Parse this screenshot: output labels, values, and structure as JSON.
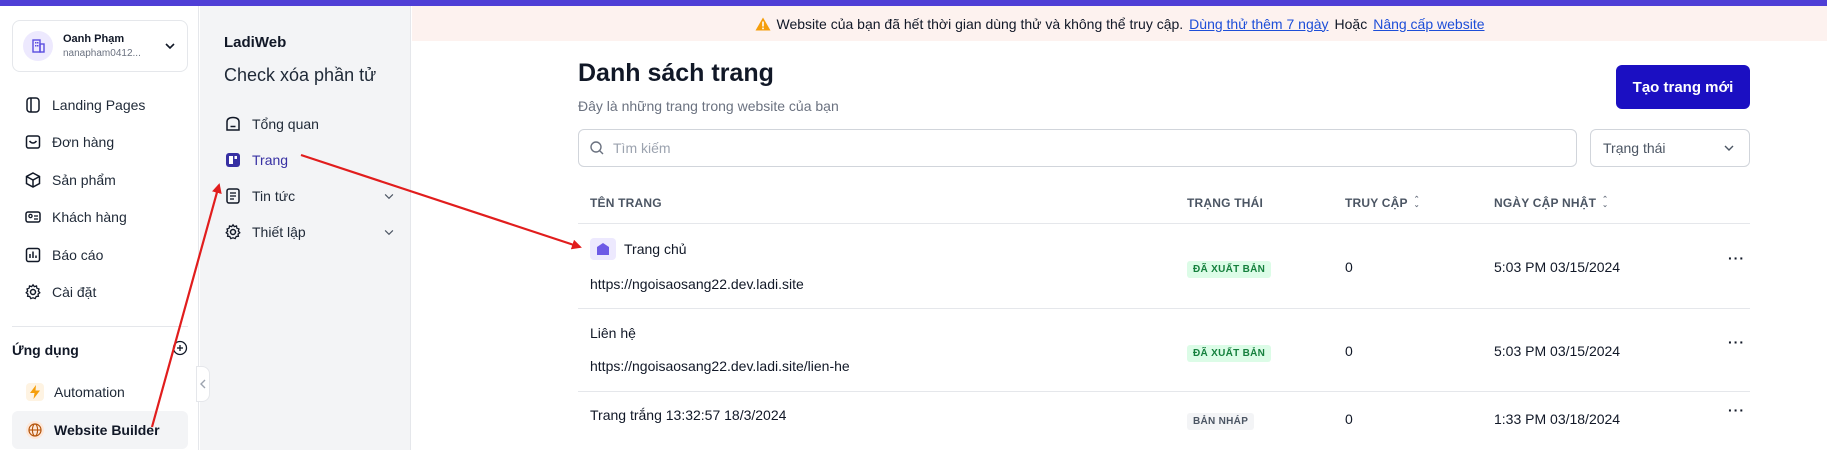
{
  "colors": {
    "accent": "#1b0fc2",
    "topbar": "#4f3fd6",
    "banner_bg": "#fdf2ef",
    "link": "#2563eb",
    "annotation": "#e11d1d"
  },
  "account": {
    "name": "Oanh Phạm",
    "email": "nanapham0412...",
    "icon": "building-icon"
  },
  "sidebar": {
    "items": [
      {
        "label": "Landing Pages",
        "icon": "landing-pages-icon"
      },
      {
        "label": "Đơn hàng",
        "icon": "orders-icon"
      },
      {
        "label": "Sản phẩm",
        "icon": "box-icon"
      },
      {
        "label": "Khách hàng",
        "icon": "contact-card-icon"
      },
      {
        "label": "Báo cáo",
        "icon": "bar-chart-icon"
      },
      {
        "label": "Cài đặt",
        "icon": "gear-icon"
      }
    ],
    "apps_title": "Ứng dụng",
    "apps": [
      {
        "label": "Automation",
        "icon": "lightning-icon"
      },
      {
        "label": "Website Builder",
        "icon": "globe-icon",
        "active": true
      }
    ]
  },
  "subnav": {
    "brand": "LadiWeb",
    "site_name": "Check xóa phần tử",
    "items": [
      {
        "label": "Tổng quan",
        "icon": "overview-icon"
      },
      {
        "label": "Trang",
        "icon": "page-icon",
        "active": true
      },
      {
        "label": "Tin tức",
        "icon": "news-icon",
        "expandable": true
      },
      {
        "label": "Thiết lập",
        "icon": "gear-icon",
        "expandable": true
      }
    ]
  },
  "banner": {
    "message": "Website của bạn đã hết thời gian dùng thử và không thể truy cập.",
    "trial_link": "Dùng thử thêm 7 ngày",
    "separator": "Hoặc",
    "upgrade_link": "Nâng cấp website"
  },
  "main": {
    "title": "Danh sách trang",
    "subtitle": "Đây là những trang trong website của bạn",
    "create_button": "Tạo trang mới",
    "search_placeholder": "Tìm kiếm",
    "status_filter": "Trạng thái"
  },
  "table": {
    "columns": [
      "TÊN TRANG",
      "TRẠNG THÁI",
      "TRUY CẬP",
      "NGÀY CẬP NHẬT"
    ],
    "rows": [
      {
        "name": "Trang chủ",
        "url": "https://ngoisaosang22.dev.ladi.site",
        "status": "ĐÃ XUẤT BẢN",
        "visits": "0",
        "updated": "5:03 PM 03/15/2024",
        "is_home": true
      },
      {
        "name": "Liên hệ",
        "url": "https://ngoisaosang22.dev.ladi.site/lien-he",
        "status": "ĐÃ XUẤT BẢN",
        "visits": "0",
        "updated": "5:03 PM 03/15/2024"
      },
      {
        "name": "Trang trắng 13:32:57 18/3/2024",
        "url": "",
        "status": "BẢN NHÁP",
        "visits": "0",
        "updated": "1:33 PM 03/18/2024"
      }
    ]
  }
}
